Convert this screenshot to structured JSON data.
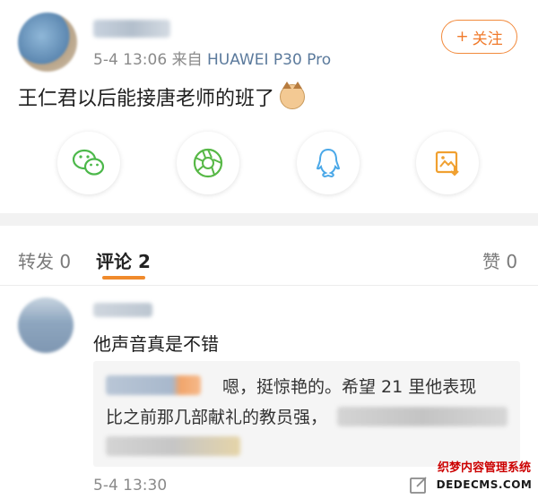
{
  "post": {
    "time": "5-4 13:06",
    "source_prefix": "来自",
    "device": "HUAWEI P30 Pro",
    "follow_label": "关注",
    "text": "王仁君以后能接唐老师的班了"
  },
  "share": [
    {
      "icon": "wechat-icon",
      "color": "#4cb84a"
    },
    {
      "icon": "moments-icon",
      "color": "#57b846"
    },
    {
      "icon": "qq-icon",
      "color": "#4aa8e8"
    },
    {
      "icon": "save-image-icon",
      "color": "#f0a030"
    }
  ],
  "tabs": {
    "repost": {
      "label": "转发",
      "count": "0"
    },
    "comments": {
      "label": "评论",
      "count": "2"
    },
    "likes": {
      "label": "赞",
      "count": "0"
    }
  },
  "comment": {
    "text": "他声音真是不错",
    "time": "5-4 13:30",
    "reply": {
      "line1": "嗯，挺惊艳的。希望 21 里他表现",
      "line2": "比之前那几部献礼的教员强，"
    }
  },
  "watermark": {
    "line1": "织梦内容管理系统",
    "line2": "DEDECMS.COM"
  },
  "colors": {
    "accent": "#f07a2b",
    "source_link": "#5b7a9c"
  }
}
